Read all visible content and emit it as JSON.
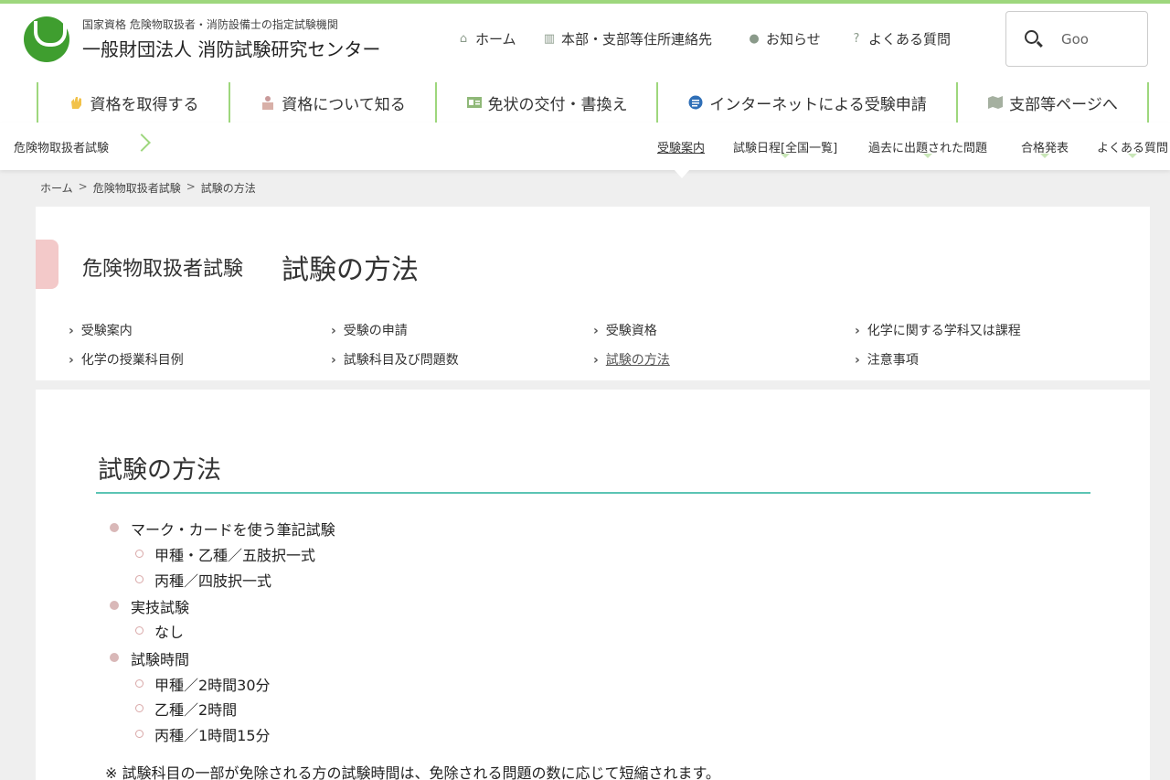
{
  "header": {
    "org_sub": "国家資格 危険物取扱者・消防設備士の指定試験機関",
    "org_name": "一般財団法人 消防試験研究センター",
    "util": [
      {
        "icon": "home-icon",
        "label": "ホーム"
      },
      {
        "icon": "map-icon",
        "label": "本部・支部等住所連絡先"
      },
      {
        "icon": "info-icon",
        "label": "お知らせ"
      },
      {
        "icon": "question-icon",
        "label": "よくある質問"
      }
    ],
    "search_placeholder": "Goo"
  },
  "global_nav": [
    {
      "icon": "hand-icon",
      "label": "資格を取得する"
    },
    {
      "icon": "people-icon",
      "label": "資格について知る"
    },
    {
      "icon": "license-card-icon",
      "label": "免状の交付・書換え"
    },
    {
      "icon": "internet-icon",
      "label": "インターネットによる受験申請"
    },
    {
      "icon": "map-icon",
      "label": "支部等ページへ"
    }
  ],
  "subbar": {
    "category": "危険物取扱者試験",
    "links": [
      {
        "label": "受験案内",
        "active": true
      },
      {
        "label": "試験日程[全国一覧]",
        "active": false
      },
      {
        "label": "過去に出題された問題",
        "active": false
      },
      {
        "label": "合格発表",
        "active": false
      },
      {
        "label": "よくある質問",
        "active": false
      }
    ]
  },
  "breadcrumb": [
    "ホーム",
    "危険物取扱者試験",
    "試験の方法"
  ],
  "breadcrumb_sep": ">",
  "hero": {
    "title_small": "危険物取扱者試験",
    "title_big": "試験の方法",
    "toc": [
      "受験案内",
      "受験の申請",
      "受験資格",
      "化学に関する学科又は課程",
      "化学の授業科目例",
      "試験科目及び問題数",
      "試験の方法",
      "注意事項"
    ],
    "toc_current": "試験の方法"
  },
  "content": {
    "heading": "試験の方法",
    "sections": [
      {
        "label": "マーク・カードを使う筆記試験",
        "items": [
          "甲種・乙種／五肢択一式",
          "丙種／四肢択一式"
        ]
      },
      {
        "label": "実技試験",
        "items": [
          "なし"
        ]
      },
      {
        "label": "試験時間",
        "items": [
          "甲種／2時間30分",
          "乙種／2時間",
          "丙種／1時間15分"
        ]
      }
    ],
    "note": "※ 試験科目の一部が免除される方の試験時間は、免除される問題の数に応じて短縮されます。"
  },
  "colors": {
    "accent_green": "#9ed77d",
    "logo_green": "#3f9e2f",
    "rule_teal": "#5bc4b4",
    "accent_pink": "#f3c9c9"
  }
}
